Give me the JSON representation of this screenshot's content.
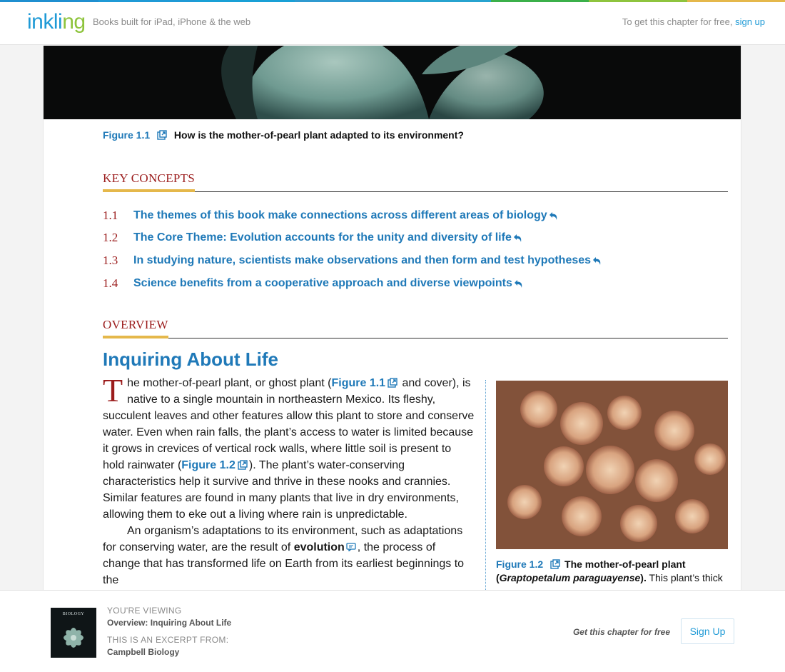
{
  "header": {
    "logo_text_a": "inkli",
    "logo_text_b": "ng",
    "tagline": "Books built for iPad, iPhone & the web",
    "cta_prefix": "To get this chapter for free,",
    "cta_link": "sign up",
    "colors": [
      "#1f9ad6",
      "#1f9ad6",
      "#1f9ad6",
      "#19a0d6",
      "#2f8fd0",
      "#3bb04a",
      "#8ec43d",
      "#e5b84b"
    ]
  },
  "figure_top": {
    "label": "Figure 1.1",
    "caption": "How is the mother-of-pearl plant adapted to its environment?"
  },
  "key_concepts": {
    "heading": "KEY CONCEPTS",
    "items": [
      {
        "num": "1.1",
        "text": "The themes of this book make connections across different areas of biology"
      },
      {
        "num": "1.2",
        "text": "The Core Theme: Evolution accounts for the unity and diversity of life"
      },
      {
        "num": "1.3",
        "text": "In studying nature, scientists make observations and then form and test hypotheses"
      },
      {
        "num": "1.4",
        "text": "Science benefits from a cooperative approach and diverse viewpoints"
      }
    ]
  },
  "overview": {
    "heading": "OVERVIEW",
    "title": "Inquiring About Life",
    "dropcap": "T",
    "p1_a": "he mother-of-pearl plant, or ghost plant (",
    "p1_fig1": "Figure 1.1",
    "p1_b": " and cover), is native to a single mountain in northeastern Mexico. Its fleshy, succulent leaves and other features allow this plant to store and conserve water. Even when rain falls, the plant’s access to water is limited because it grows in crevices of vertical rock walls, where little soil is present to hold rainwater (",
    "p1_fig2": "Figure 1.2",
    "p1_c": "). The plant’s water-conserving characteristics help it survive and thrive in these nooks and crannies. Similar features are found in many plants that live in dry environments, allowing them to eke out a living where rain is unpredictable.",
    "p2_a": "An organism’s adaptations to its environment, such as adaptations for conserving water, are the result of ",
    "p2_term": "evolution",
    "p2_b": ", the process of change that has transformed life on Earth from its earliest beginnings to the"
  },
  "figure_side": {
    "label": "Figure 1.2",
    "caption_bold_a": "The mother-of-pearl plant (",
    "caption_italic": "Graptopetalum paraguayense",
    "caption_bold_b": ").",
    "caption_rest": " This plant’s thick"
  },
  "footer": {
    "cover_title": "BIOLOGY",
    "viewing_label": "YOU'RE VIEWING",
    "viewing_value": "Overview: Inquiring About Life",
    "excerpt_label": "THIS IS AN EXCERPT FROM:",
    "excerpt_value": "Campbell Biology",
    "free_text": "Get this chapter for free",
    "signup_label": "Sign Up"
  }
}
